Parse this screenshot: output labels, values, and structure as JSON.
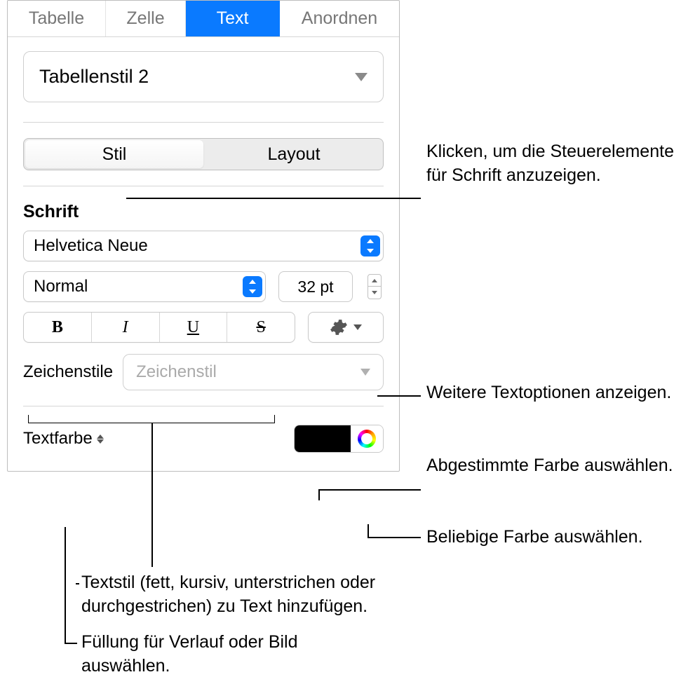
{
  "tabs": {
    "t0": "Tabelle",
    "t1": "Zelle",
    "t2": "Text",
    "t3": "Anordnen"
  },
  "style_name": "Tabellenstil 2",
  "seg": {
    "stil": "Stil",
    "layout": "Layout"
  },
  "font": {
    "heading": "Schrift",
    "family": "Helvetica Neue",
    "weight": "Normal",
    "size": "32 pt"
  },
  "buttons": {
    "bold": "B",
    "italic": "I",
    "underline": "U",
    "strike": "S"
  },
  "charstyles": {
    "label": "Zeichenstile",
    "placeholder": "Zeichenstil"
  },
  "textcolor": {
    "label": "Textfarbe"
  },
  "callouts": {
    "c1": "Klicken, um die Steuerelemente für Schrift anzuzeigen.",
    "c2": "Weitere Textoptionen anzeigen.",
    "c3": "Abgestimmte Farbe auswählen.",
    "c4": "Beliebige Farbe auswählen.",
    "c5": "Textstil (fett, kursiv, unterstrichen oder durchgestrichen) zu Text hinzufügen.",
    "c6": "Füllung für Verlauf oder Bild auswählen."
  }
}
